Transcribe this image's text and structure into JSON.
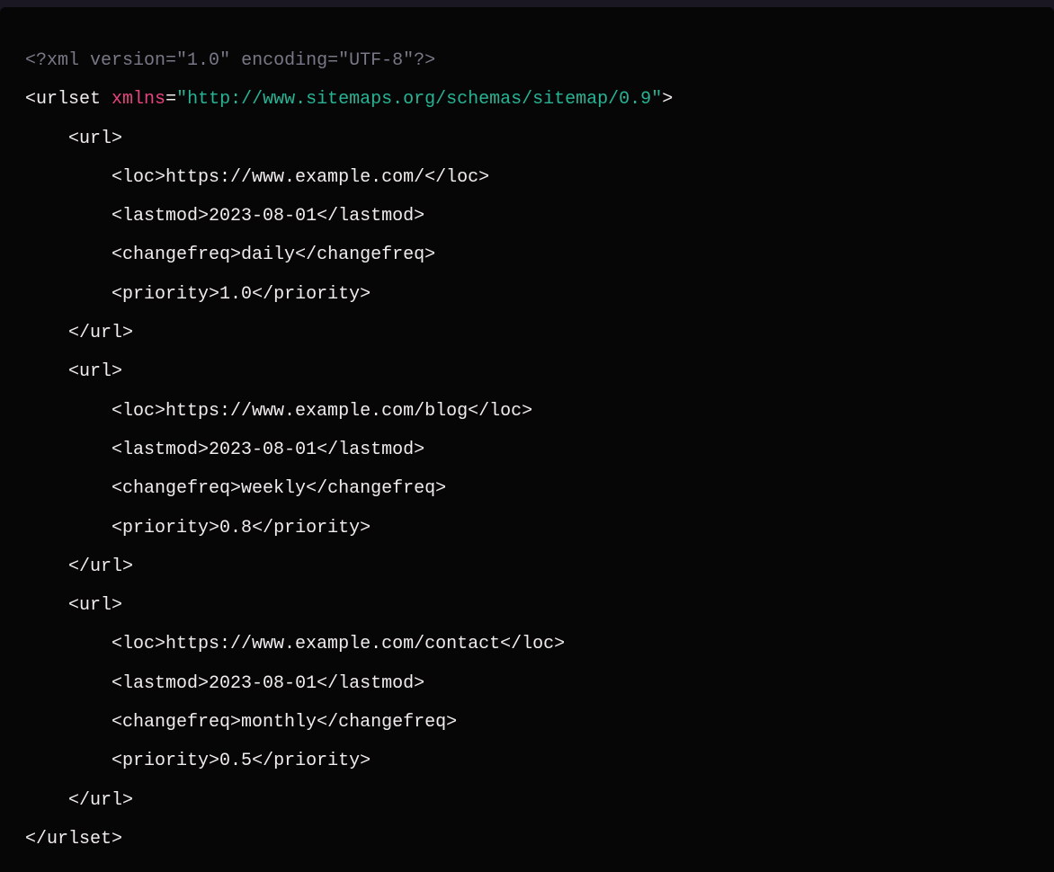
{
  "xml": {
    "declaration": {
      "open": "<?xml ",
      "version_attr": "version",
      "version_q1": "=\"",
      "version_val": "1.0",
      "between": "\" ",
      "encoding_attr": "encoding",
      "encoding_q1": "=\"",
      "encoding_val": "UTF-8",
      "close": "\"?>"
    },
    "urlset_open": {
      "lt": "<",
      "tag": "urlset",
      "space": " ",
      "attr": "xmlns",
      "eq": "=",
      "q1": "\"",
      "val": "http://www.sitemaps.org/schemas/sitemap/0.9",
      "q2": "\"",
      "gt": ">"
    },
    "tags": {
      "url_open": "<url>",
      "url_close": "</url>",
      "loc_open": "<loc>",
      "loc_close": "</loc>",
      "lastmod_open": "<lastmod>",
      "lastmod_close": "</lastmod>",
      "changefreq_open": "<changefreq>",
      "changefreq_close": "</changefreq>",
      "priority_open": "<priority>",
      "priority_close": "</priority>",
      "urlset_close": "</urlset>"
    },
    "urls": [
      {
        "loc": "https://www.example.com/",
        "lastmod": "2023-08-01",
        "changefreq": "daily",
        "priority": "1.0"
      },
      {
        "loc": "https://www.example.com/blog",
        "lastmod": "2023-08-01",
        "changefreq": "weekly",
        "priority": "0.8"
      },
      {
        "loc": "https://www.example.com/contact",
        "lastmod": "2023-08-01",
        "changefreq": "monthly",
        "priority": "0.5"
      }
    ],
    "indent1": "    ",
    "indent2": "        "
  }
}
